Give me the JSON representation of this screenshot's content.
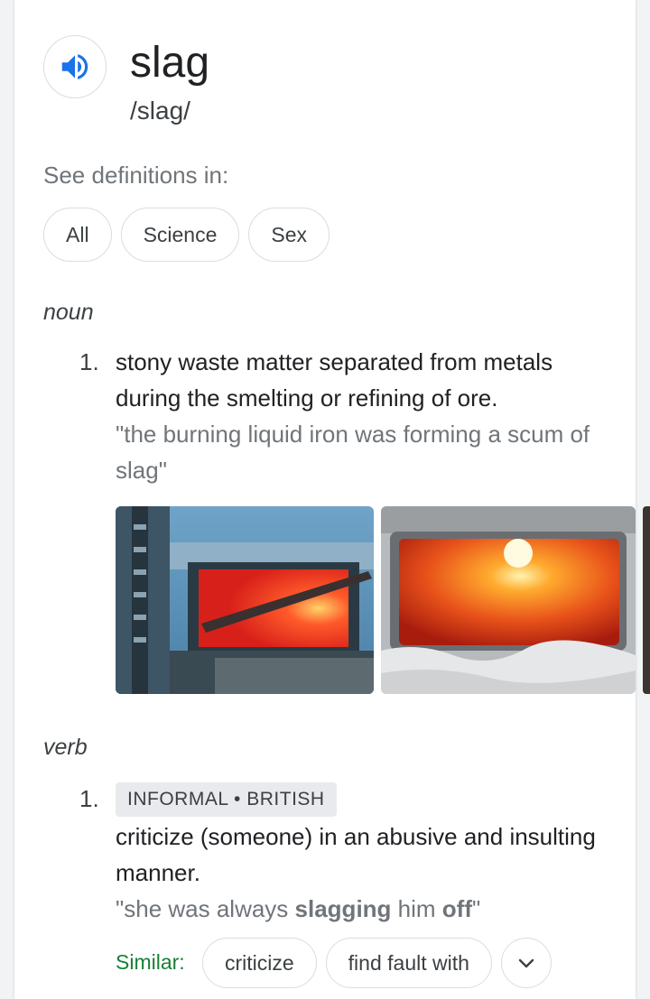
{
  "entry": {
    "word": "slag",
    "phonetic": "/slag/",
    "audio_icon": "speaker-icon",
    "accent_color": "#1a73e8"
  },
  "see_definitions": {
    "label": "See definitions in:",
    "chips": [
      "All",
      "Science",
      "Sex"
    ]
  },
  "noun": {
    "label": "noun",
    "senses": [
      {
        "number": "1.",
        "definition": "stony waste matter separated from metals during the smelting or refining of ore.",
        "example": "\"the burning liquid iron was forming a scum of slag\""
      }
    ]
  },
  "verb": {
    "label": "verb",
    "senses": [
      {
        "number": "1.",
        "tags": "INFORMAL • BRITISH",
        "definition": "criticize (someone) in an abusive and insulting manner.",
        "example_prefix": "\"she was always ",
        "example_bold1": "slagging",
        "example_mid": " him ",
        "example_bold2": "off",
        "example_suffix": "\"",
        "similar_label": "Similar:",
        "similar": [
          "criticize",
          "find fault with"
        ],
        "expand_icon": "chevron-down-icon"
      }
    ]
  },
  "colors": {
    "similar_label": "#188038",
    "muted_text": "#70757a",
    "chip_border": "#dadce0"
  }
}
